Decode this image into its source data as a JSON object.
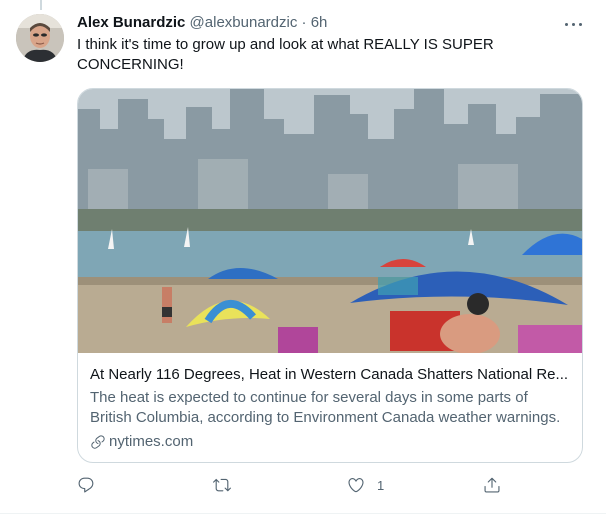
{
  "tweet": {
    "author_name": "Alex Bunardzic",
    "author_handle": "@alexbunardzic",
    "separator": "·",
    "timestamp": "6h",
    "text": "I think it's time to grow up and look at what REALLY IS SUPER CONCERNING!"
  },
  "card": {
    "title": "At Nearly 116 Degrees, Heat in Western Canada Shatters National Re...",
    "description": "The heat is expected to continue for several days in some parts of British Columbia, according to Environment Canada weather warnings.",
    "domain": "nytimes.com"
  },
  "actions": {
    "reply_count": "",
    "retweet_count": "",
    "like_count": "1"
  },
  "icons": {
    "more": "more-icon",
    "reply": "reply-icon",
    "retweet": "retweet-icon",
    "like": "heart-icon",
    "share": "share-icon",
    "link": "link-icon"
  },
  "colors": {
    "text_primary": "#0f1419",
    "text_secondary": "#536471",
    "border": "#cfd9de"
  }
}
